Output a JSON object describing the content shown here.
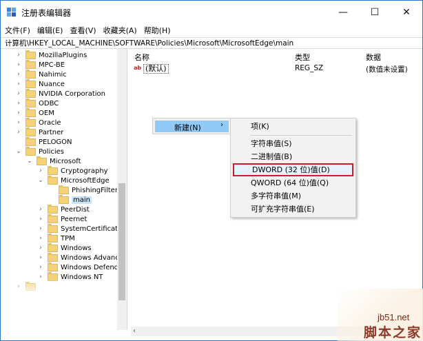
{
  "window": {
    "title": "注册表编辑器",
    "minimize": "—",
    "maximize": "☐",
    "close": "✕"
  },
  "menu": [
    "文件(F)",
    "编辑(E)",
    "查看(V)",
    "收藏夹(A)",
    "帮助(H)"
  ],
  "address": "计算机\\HKEY_LOCAL_MACHINE\\SOFTWARE\\Policies\\Microsoft\\MicrosoftEdge\\main",
  "tree": [
    {
      "label": "MozillaPlugins",
      "expander": "›",
      "selected": false
    },
    {
      "label": "MPC-BE",
      "expander": "›",
      "selected": false
    },
    {
      "label": "Nahimic",
      "expander": "›",
      "selected": false
    },
    {
      "label": "Nuance",
      "expander": "›",
      "selected": false
    },
    {
      "label": "NVIDIA Corporation",
      "expander": "›",
      "selected": false
    },
    {
      "label": "ODBC",
      "expander": "›",
      "selected": false
    },
    {
      "label": "OEM",
      "expander": "›",
      "selected": false
    },
    {
      "label": "Oracle",
      "expander": "›",
      "selected": false
    },
    {
      "label": "Partner",
      "expander": "›",
      "selected": false
    },
    {
      "label": "PELOGON",
      "expander": "",
      "selected": false
    },
    {
      "label": "Policies",
      "expander": "⌄",
      "selected": false
    },
    {
      "label": "Microsoft",
      "expander": "⌄",
      "selected": false
    },
    {
      "label": "Cryptography",
      "expander": "›",
      "selected": false
    },
    {
      "label": "MicrosoftEdge",
      "expander": "⌄",
      "selected": false
    },
    {
      "label": "PhishingFilter",
      "expander": "",
      "selected": false
    },
    {
      "label": "main",
      "expander": "",
      "selected": true
    },
    {
      "label": "PeerDist",
      "expander": "›",
      "selected": false
    },
    {
      "label": "Peernet",
      "expander": "›",
      "selected": false
    },
    {
      "label": "SystemCertificates",
      "expander": "›",
      "selected": false
    },
    {
      "label": "TPM",
      "expander": "›",
      "selected": false
    },
    {
      "label": "Windows",
      "expander": "›",
      "selected": false
    },
    {
      "label": "Windows Advanced",
      "expander": "›",
      "selected": false
    },
    {
      "label": "Windows Defender",
      "expander": "›",
      "selected": false
    },
    {
      "label": "Windows NT",
      "expander": "›",
      "selected": false
    }
  ],
  "columns": {
    "name": "名称",
    "type": "类型",
    "data": "数据"
  },
  "values": [
    {
      "icon": "ab",
      "name": "(默认)",
      "type": "REG_SZ",
      "data": "(数值未设置)"
    }
  ],
  "context_menu": {
    "new_label": "新建(N)",
    "arrow": "›"
  },
  "submenu": {
    "key": "项(K)",
    "string": "字符串值(S)",
    "binary": "二进制值(B)",
    "dword": "DWORD (32 位)值(D)",
    "qword": "QWORD (64 位)值(Q)",
    "multi_string": "多字符串值(M)",
    "expandable_string": "可扩充字符串值(E)"
  },
  "scroll": {
    "left": "‹",
    "right": "›"
  },
  "watermark": {
    "site": "jb51.net",
    "brand": "脚本之家"
  },
  "colors": {
    "highlight_border": "#c8202a",
    "menu_hover": "#91c9f7",
    "folder": "#f4d27a",
    "selection": "#cce4f7"
  }
}
